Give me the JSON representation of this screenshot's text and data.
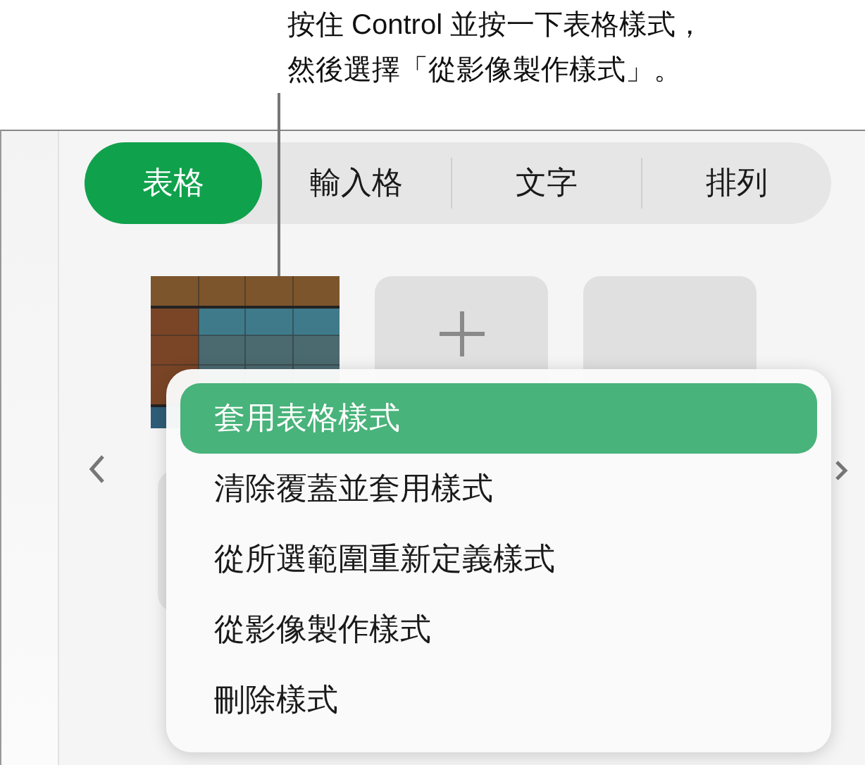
{
  "callout": {
    "lines": [
      "按住 Control 並按一下表格樣式，",
      "然後選擇「從影像製作樣式」。"
    ]
  },
  "tabs": [
    {
      "label": "表格",
      "selected": true
    },
    {
      "label": "輸入格",
      "selected": false
    },
    {
      "label": "文字",
      "selected": false
    },
    {
      "label": "排列",
      "selected": false
    }
  ],
  "styles": [
    {
      "kind": "table"
    },
    {
      "kind": "add"
    },
    {
      "kind": "empty"
    }
  ],
  "context_menu": {
    "items": [
      {
        "label": "套用表格樣式",
        "selected": true
      },
      {
        "label": "清除覆蓋並套用樣式",
        "selected": false
      },
      {
        "label": "從所選範圍重新定義樣式",
        "selected": false
      },
      {
        "label": "從影像製作樣式",
        "selected": false
      },
      {
        "label": "刪除樣式",
        "selected": false
      }
    ]
  }
}
